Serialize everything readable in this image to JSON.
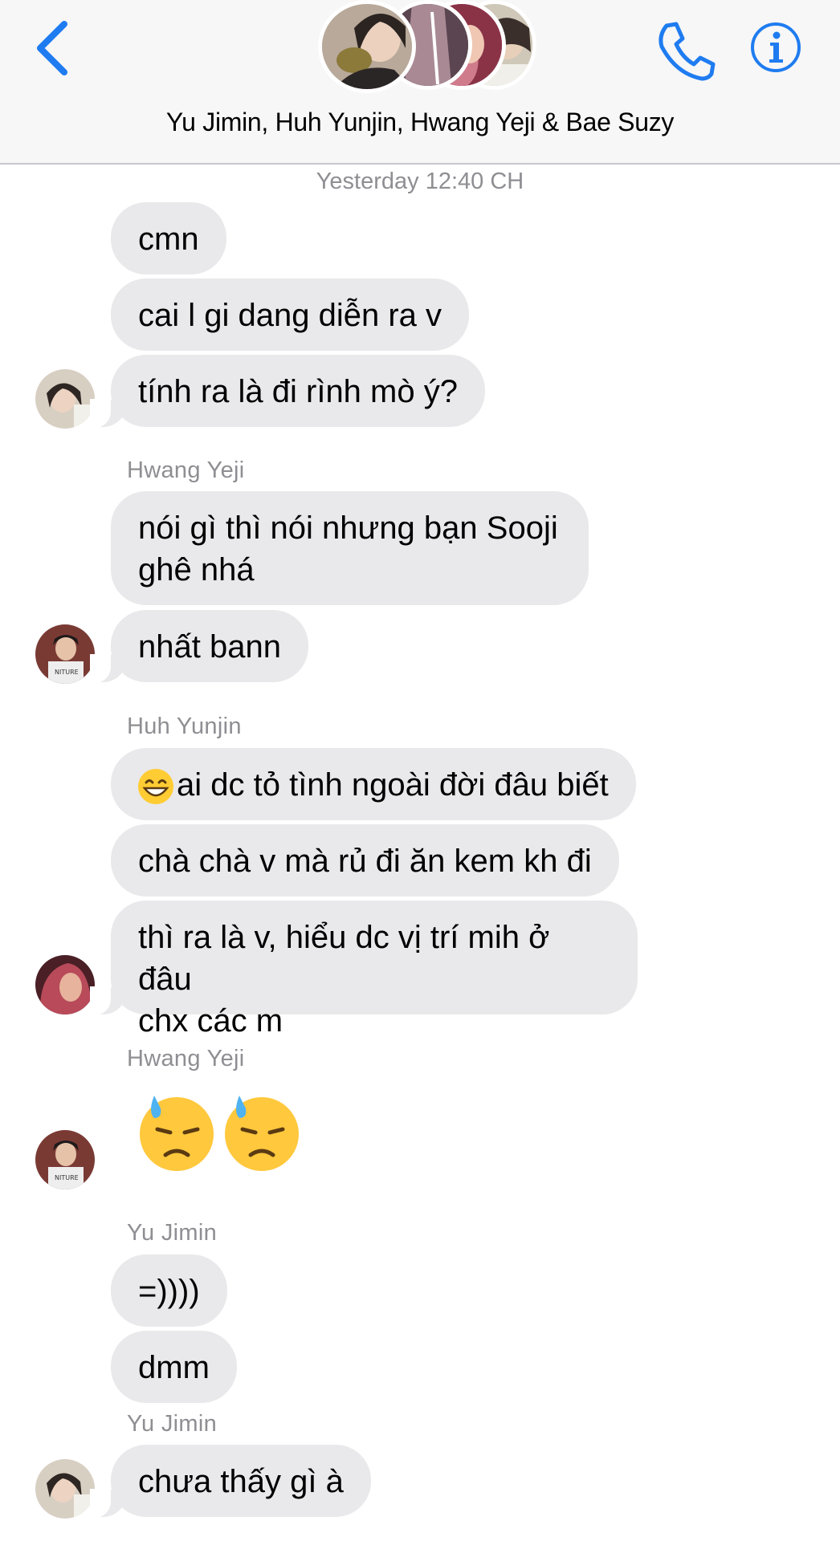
{
  "header": {
    "title": "Yu Jimin, Huh Yunjin, Hwang Yeji & Bae Suzy",
    "back_icon": "chevron-left-icon",
    "call_icon": "phone-icon",
    "info_icon": "info-icon",
    "accent": "#1f7cf0"
  },
  "conversation": {
    "timestamp": "Yesterday 12:40 CH",
    "bubble_color": "#e9e9eb",
    "sender_color": "#8e8e93",
    "senders": [
      "Hwang Yeji",
      "Huh Yunjin",
      "Hwang Yeji",
      "Yu Jimin",
      "Yu Jimin"
    ],
    "messages": [
      "cmn",
      "cai l gi dang diễn ra v",
      "tính ra là đi rình mò ý?",
      "nói gì thì nói nhưng bạn Sooji",
      "ghê nhá",
      "nhất bann",
      "ai dc tỏ tình ngoài đời đâu biết",
      "chà chà v mà rủ đi ăn kem kh đi",
      "thì ra là v, hiểu dc vị trí mih ở đâu",
      "chx các m",
      "=))))",
      "dmm",
      "chưa thấy gì à"
    ],
    "emoji_icons": [
      "grinning-face-icon",
      "downcast-face-with-sweat-icon"
    ]
  }
}
